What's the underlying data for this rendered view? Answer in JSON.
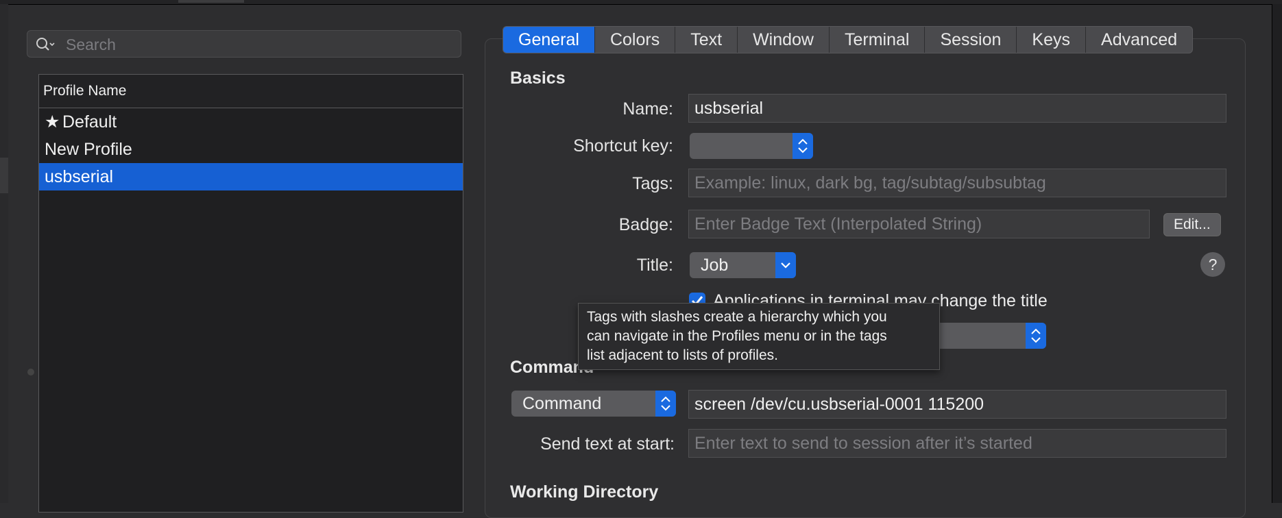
{
  "search": {
    "placeholder": "Search"
  },
  "profiles": {
    "header": "Profile Name",
    "items": [
      {
        "label": "Default",
        "icon": "star-icon"
      },
      {
        "label": "New Profile"
      },
      {
        "label": "usbserial"
      }
    ]
  },
  "tabs": [
    "General",
    "Colors",
    "Text",
    "Window",
    "Terminal",
    "Session",
    "Keys",
    "Advanced"
  ],
  "basics": {
    "heading": "Basics",
    "name_label": "Name:",
    "name_value": "usbserial",
    "shortcut_label": "Shortcut key:",
    "tags_label": "Tags:",
    "tags_placeholder": "Example: linux, dark bg, tag/subtag/subsubtag",
    "badge_label": "Badge:",
    "badge_placeholder": "Enter Badge Text (Interpolated String)",
    "edit_button": "Edit...",
    "title_label": "Title:",
    "title_value": "Job",
    "help": "?",
    "apps_change_title": "Applications in terminal may change the title"
  },
  "tooltip": {
    "lines": [
      "Tags with slashes create a hierarchy which you",
      "can navigate in the Profiles menu or in the tags",
      "list adjacent to lists of profiles."
    ]
  },
  "command": {
    "heading": "Command",
    "mode": "Command",
    "value": "screen /dev/cu.usbserial-0001 115200",
    "send_text_label": "Send text at start:",
    "send_text_placeholder": "Enter text to send to session after it’s started"
  },
  "working_directory": {
    "heading": "Working Directory"
  },
  "colors": {
    "accent": "#1a6ae0",
    "selection": "#1660d3"
  }
}
